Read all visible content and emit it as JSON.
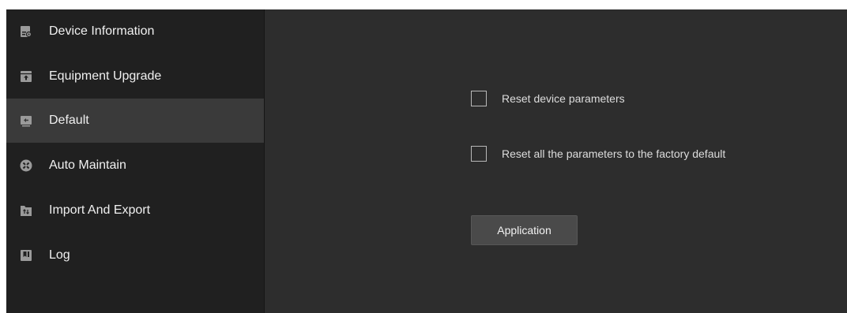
{
  "sidebar": {
    "items": [
      {
        "label": "Device Information",
        "icon": "device-info-icon",
        "active": false
      },
      {
        "label": "Equipment Upgrade",
        "icon": "upgrade-icon",
        "active": false
      },
      {
        "label": "Default",
        "icon": "default-icon",
        "active": true
      },
      {
        "label": "Auto Maintain",
        "icon": "wrench-icon",
        "active": false
      },
      {
        "label": "Import And Export",
        "icon": "import-export-icon",
        "active": false
      },
      {
        "label": "Log",
        "icon": "log-icon",
        "active": false
      }
    ]
  },
  "main": {
    "options": [
      {
        "label": "Reset device parameters",
        "checked": false
      },
      {
        "label": "Reset all the parameters to the factory default",
        "checked": false
      }
    ],
    "apply_label": "Application"
  },
  "colors": {
    "sidebar_bg": "#202020",
    "active_item_bg": "#3a3a3a",
    "content_bg": "#2d2d2d",
    "icon_color": "#9a9a9a",
    "text_color": "#f0f0f0",
    "button_bg": "#4a4a4a"
  }
}
